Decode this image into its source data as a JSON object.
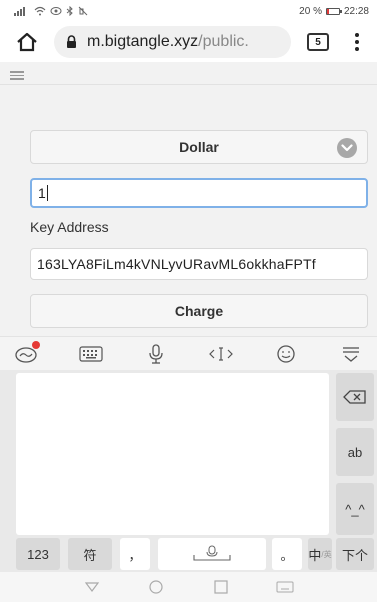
{
  "status_bar": {
    "left_icons": [
      "signal-icon",
      "wifi-icon",
      "eye-icon",
      "bluetooth-icon",
      "mute-icon"
    ],
    "battery_percent": "20 %",
    "battery_level": 0.2,
    "time": "22:28"
  },
  "browser": {
    "url_host": "m.bigtangle.xyz",
    "url_path": "/public.",
    "tab_count": "5"
  },
  "form": {
    "currency_selected": "Dollar",
    "amount_value": "1",
    "key_label": "Key Address",
    "key_address_value": "163LYA8FiLm4kVNLyvURavML6okkhaFPTf",
    "charge_label": "Charge"
  },
  "keyboard": {
    "toolbar_icons": [
      "ime-logo-icon",
      "keyboard-icon",
      "microphone-icon",
      "cursor-icon",
      "emoji-icon",
      "collapse-icon"
    ],
    "side_keys": {
      "ab": "ab",
      "emoticon": "^_^"
    },
    "bottom_keys": {
      "num": "123",
      "symbol": "符",
      "comma": "，",
      "period": "。",
      "lang": "中",
      "lang_sub": "/英",
      "next": "下个"
    }
  },
  "colors": {
    "focus_border": "#7fb1e8",
    "notification_dot": "#e53935",
    "battery_low": "#e03a3a"
  }
}
